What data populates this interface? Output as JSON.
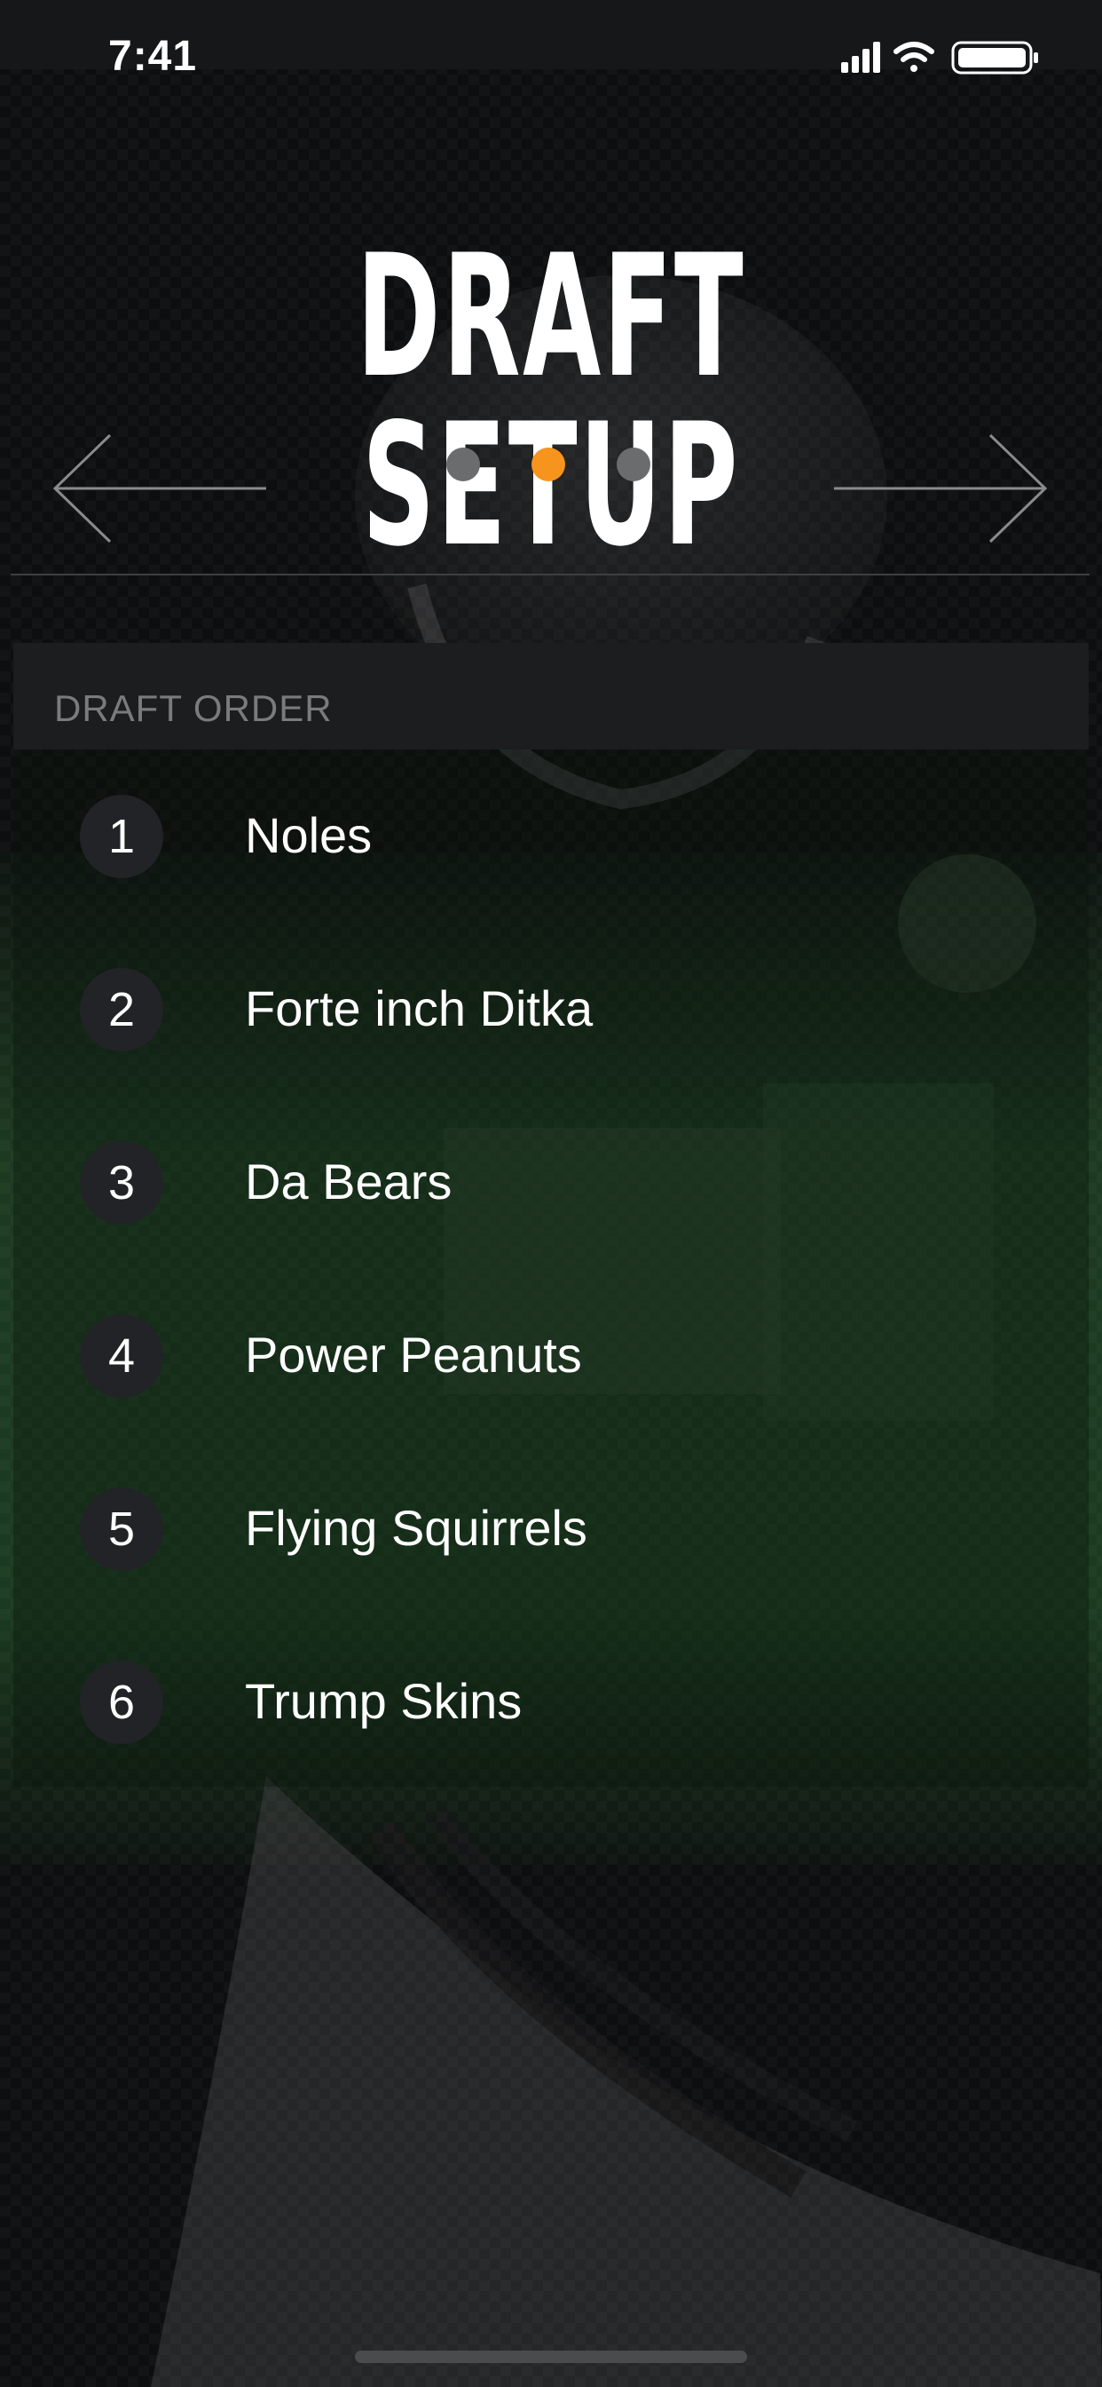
{
  "status_bar": {
    "time": "7:41",
    "icons": [
      "cellular-signal-icon",
      "wifi-icon",
      "battery-icon"
    ]
  },
  "header": {
    "title": "DRAFT SETUP",
    "prev_icon": "arrow-left-icon",
    "next_icon": "arrow-right-icon",
    "pager": {
      "total": 3,
      "active_index": 1
    }
  },
  "section": {
    "title": "DRAFT ORDER"
  },
  "teams": [
    {
      "rank": "1",
      "name": "Noles"
    },
    {
      "rank": "2",
      "name": "Forte inch Ditka"
    },
    {
      "rank": "3",
      "name": "Da Bears"
    },
    {
      "rank": "4",
      "name": "Power Peanuts"
    },
    {
      "rank": "5",
      "name": "Flying Squirrels"
    },
    {
      "rank": "6",
      "name": "Trump Skins"
    }
  ],
  "colors": {
    "accent": "#f7941d",
    "inactive_dot": "#6b6c6d",
    "background": "#0d0e0f",
    "section_header": "#1c1d1e",
    "field_green": "#1f3a22"
  }
}
